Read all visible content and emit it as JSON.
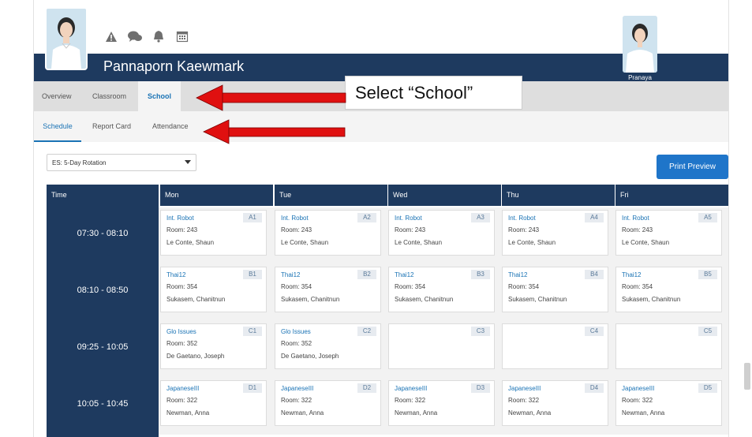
{
  "header": {
    "user_name": "Pannaporn Kaewmark",
    "alt_user_name": "Pranaya",
    "icons": [
      "warning-icon",
      "chat-icon",
      "bell-icon",
      "calendar-icon"
    ]
  },
  "primary_tabs": [
    {
      "label": "Overview",
      "active": false
    },
    {
      "label": "Classroom",
      "active": false
    },
    {
      "label": "School",
      "active": true
    }
  ],
  "secondary_tabs": [
    {
      "label": "Schedule",
      "active": true
    },
    {
      "label": "Report Card",
      "active": false
    },
    {
      "label": "Attendance",
      "active": false
    }
  ],
  "callout": {
    "text": "Select “School”"
  },
  "schedule_select": {
    "value": "ES: 5-Day Rotation"
  },
  "print_button": {
    "label": "Print Preview"
  },
  "table": {
    "time_header": "Time",
    "days": [
      "Mon",
      "Tue",
      "Wed",
      "Thu",
      "Fri"
    ],
    "rows": [
      {
        "time": "07:30 - 08:10",
        "cells": [
          {
            "block": "A1",
            "course": "Int. Robot",
            "room": "Room: 243",
            "teacher": "Le Conte, Shaun"
          },
          {
            "block": "A2",
            "course": "Int. Robot",
            "room": "Room: 243",
            "teacher": "Le Conte, Shaun"
          },
          {
            "block": "A3",
            "course": "Int. Robot",
            "room": "Room: 243",
            "teacher": "Le Conte, Shaun"
          },
          {
            "block": "A4",
            "course": "Int. Robot",
            "room": "Room: 243",
            "teacher": "Le Conte, Shaun"
          },
          {
            "block": "A5",
            "course": "Int. Robot",
            "room": "Room: 243",
            "teacher": "Le Conte, Shaun"
          }
        ]
      },
      {
        "time": "08:10 - 08:50",
        "cells": [
          {
            "block": "B1",
            "course": "Thai12",
            "room": "Room: 354",
            "teacher": "Sukasem, Chanitnun"
          },
          {
            "block": "B2",
            "course": "Thai12",
            "room": "Room: 354",
            "teacher": "Sukasem, Chanitnun"
          },
          {
            "block": "B3",
            "course": "Thai12",
            "room": "Room: 354",
            "teacher": "Sukasem, Chanitnun"
          },
          {
            "block": "B4",
            "course": "Thai12",
            "room": "Room: 354",
            "teacher": "Sukasem, Chanitnun"
          },
          {
            "block": "B5",
            "course": "Thai12",
            "room": "Room: 354",
            "teacher": "Sukasem, Chanitnun"
          }
        ]
      },
      {
        "time": "09:25 - 10:05",
        "cells": [
          {
            "block": "C1",
            "course": "Glo Issues",
            "room": "Room: 352",
            "teacher": "De Gaetano, Joseph"
          },
          {
            "block": "C2",
            "course": "Glo Issues",
            "room": "Room: 352",
            "teacher": "De Gaetano, Joseph"
          },
          {
            "block": "C3",
            "course": "",
            "room": "",
            "teacher": ""
          },
          {
            "block": "C4",
            "course": "",
            "room": "",
            "teacher": ""
          },
          {
            "block": "C5",
            "course": "",
            "room": "",
            "teacher": ""
          }
        ]
      },
      {
        "time": "10:05 - 10:45",
        "cells": [
          {
            "block": "D1",
            "course": "JapaneseIII",
            "room": "Room: 322",
            "teacher": "Newman, Anna"
          },
          {
            "block": "D2",
            "course": "JapaneseIII",
            "room": "Room: 322",
            "teacher": "Newman, Anna"
          },
          {
            "block": "D3",
            "course": "JapaneseIII",
            "room": "Room: 322",
            "teacher": "Newman, Anna"
          },
          {
            "block": "D4",
            "course": "JapaneseIII",
            "room": "Room: 322",
            "teacher": "Newman, Anna"
          },
          {
            "block": "D5",
            "course": "JapaneseIII",
            "room": "Room: 322",
            "teacher": "Newman, Anna"
          }
        ]
      }
    ]
  },
  "colors": {
    "header_navy": "#1e3a5f",
    "accent_blue": "#1a73b5",
    "print_button_blue": "#1f75c9",
    "annotation_red": "#e01010"
  }
}
